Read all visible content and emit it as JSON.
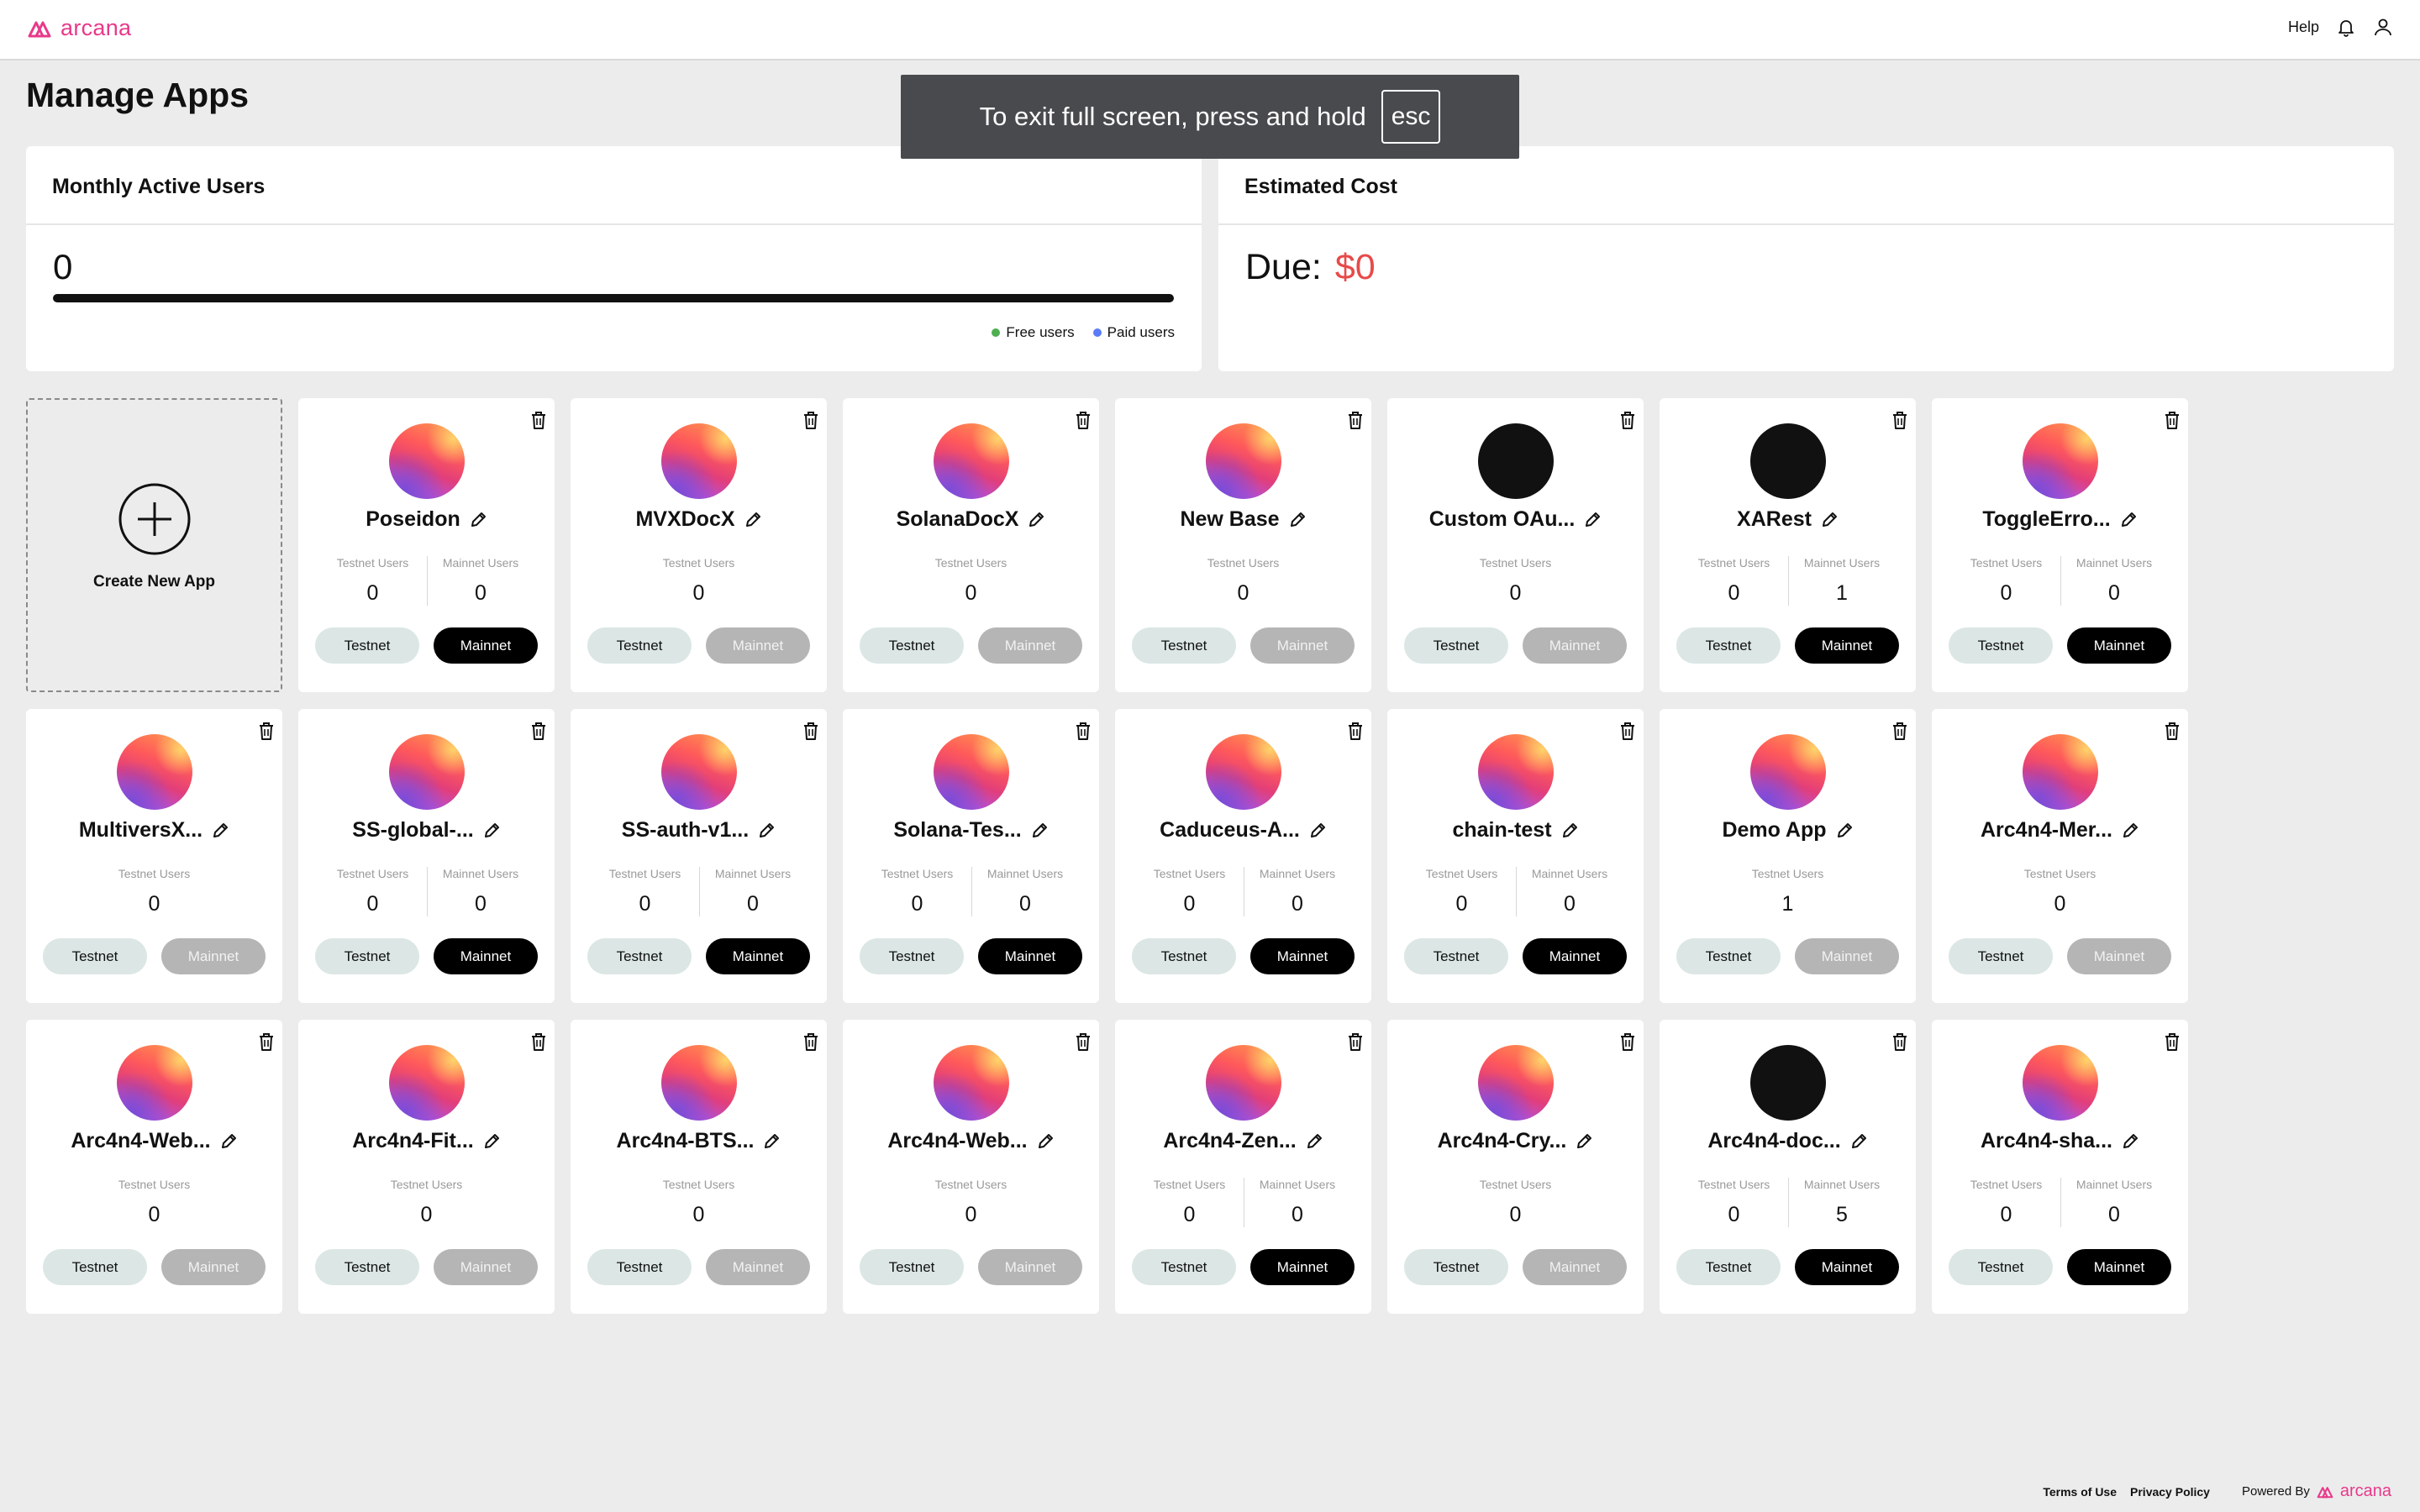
{
  "header": {
    "brand": "arcana",
    "help": "Help",
    "icons": {
      "notification": "bell-icon",
      "profile": "user-icon"
    },
    "brand_color": "#e8398a"
  },
  "page": {
    "title": "Manage Apps"
  },
  "fullscreen_toast": {
    "message": "To exit full screen, press and hold",
    "key": "esc"
  },
  "mau": {
    "title": "Monthly Active Users",
    "count": "0",
    "legend": [
      {
        "label": "Free users",
        "color": "#4caf50"
      },
      {
        "label": "Paid users",
        "color": "#5b7cf7"
      }
    ]
  },
  "cost": {
    "title": "Estimated Cost",
    "due_label": "Due:",
    "due_amount": "$0",
    "amount_color": "#e84a4a"
  },
  "create_app": {
    "label": "Create New App",
    "icon": "plus-circle-icon"
  },
  "buttons": {
    "testnet": "Testnet",
    "mainnet": "Mainnet"
  },
  "stat_labels": {
    "testnet": "Testnet Users",
    "mainnet": "Mainnet Users"
  },
  "apps": [
    {
      "name": "Poseidon",
      "avatar": "gradient",
      "testnet_users": "0",
      "mainnet_users": "0",
      "mainnet_enabled": true
    },
    {
      "name": "MVXDocX",
      "avatar": "gradient",
      "testnet_users": "0",
      "mainnet_users": null,
      "mainnet_enabled": false
    },
    {
      "name": "SolanaDocX",
      "avatar": "gradient",
      "testnet_users": "0",
      "mainnet_users": null,
      "mainnet_enabled": false
    },
    {
      "name": "New Base",
      "avatar": "gradient",
      "testnet_users": "0",
      "mainnet_users": null,
      "mainnet_enabled": false
    },
    {
      "name": "Custom OAu...",
      "avatar": "dark",
      "testnet_users": "0",
      "mainnet_users": null,
      "mainnet_enabled": false
    },
    {
      "name": "XARest",
      "avatar": "dark",
      "testnet_users": "0",
      "mainnet_users": "1",
      "mainnet_enabled": true
    },
    {
      "name": "ToggleErro...",
      "avatar": "gradient",
      "testnet_users": "0",
      "mainnet_users": "0",
      "mainnet_enabled": true
    },
    {
      "name": "MultiversX...",
      "avatar": "gradient",
      "testnet_users": "0",
      "mainnet_users": null,
      "mainnet_enabled": false
    },
    {
      "name": "SS-global-...",
      "avatar": "gradient",
      "testnet_users": "0",
      "mainnet_users": "0",
      "mainnet_enabled": true
    },
    {
      "name": "SS-auth-v1...",
      "avatar": "gradient",
      "testnet_users": "0",
      "mainnet_users": "0",
      "mainnet_enabled": true
    },
    {
      "name": "Solana-Tes...",
      "avatar": "gradient",
      "testnet_users": "0",
      "mainnet_users": "0",
      "mainnet_enabled": true
    },
    {
      "name": "Caduceus-A...",
      "avatar": "gradient",
      "testnet_users": "0",
      "mainnet_users": "0",
      "mainnet_enabled": true
    },
    {
      "name": "chain-test",
      "avatar": "gradient",
      "testnet_users": "0",
      "mainnet_users": "0",
      "mainnet_enabled": true
    },
    {
      "name": "Demo App",
      "avatar": "gradient",
      "testnet_users": "1",
      "mainnet_users": null,
      "mainnet_enabled": false
    },
    {
      "name": "Arc4n4-Mer...",
      "avatar": "gradient",
      "testnet_users": "0",
      "mainnet_users": null,
      "mainnet_enabled": false
    },
    {
      "name": "Arc4n4-Web...",
      "avatar": "gradient",
      "testnet_users": "0",
      "mainnet_users": null,
      "mainnet_enabled": false
    },
    {
      "name": "Arc4n4-Fit...",
      "avatar": "gradient",
      "testnet_users": "0",
      "mainnet_users": null,
      "mainnet_enabled": false
    },
    {
      "name": "Arc4n4-BTS...",
      "avatar": "gradient",
      "testnet_users": "0",
      "mainnet_users": null,
      "mainnet_enabled": false
    },
    {
      "name": "Arc4n4-Web...",
      "avatar": "gradient",
      "testnet_users": "0",
      "mainnet_users": null,
      "mainnet_enabled": false
    },
    {
      "name": "Arc4n4-Zen...",
      "avatar": "gradient",
      "testnet_users": "0",
      "mainnet_users": "0",
      "mainnet_enabled": true
    },
    {
      "name": "Arc4n4-Cry...",
      "avatar": "gradient",
      "testnet_users": "0",
      "mainnet_users": null,
      "mainnet_enabled": false
    },
    {
      "name": "Arc4n4-doc...",
      "avatar": "dark",
      "testnet_users": "0",
      "mainnet_users": "5",
      "mainnet_enabled": true
    },
    {
      "name": "Arc4n4-sha...",
      "avatar": "gradient",
      "testnet_users": "0",
      "mainnet_users": "0",
      "mainnet_enabled": true
    }
  ],
  "footer": {
    "terms": "Terms of Use",
    "privacy": "Privacy Policy",
    "powered_by": "Powered By",
    "brand": "arcana"
  }
}
